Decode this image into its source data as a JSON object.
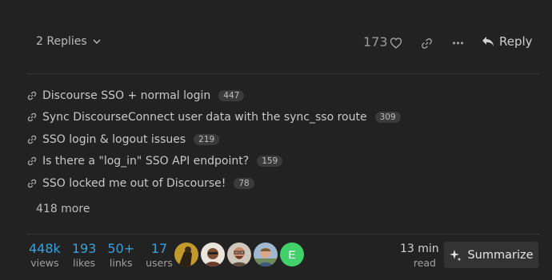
{
  "post_actions": {
    "replies_label": "2 Replies",
    "like_count": "173",
    "reply_label": "Reply"
  },
  "related_links": [
    {
      "title": "Discourse SSO + normal login",
      "count": "447"
    },
    {
      "title": "Sync DiscourseConnect user data with the sync_sso route",
      "count": "309"
    },
    {
      "title": "SSO login & logout issues",
      "count": "219"
    },
    {
      "title": "Is there a \"log_in\" SSO API endpoint?",
      "count": "159"
    },
    {
      "title": "SSO locked me out of Discourse!",
      "count": "78"
    }
  ],
  "more_links_label": "418 more",
  "topic_stats": [
    {
      "value": "448k",
      "label": "views"
    },
    {
      "value": "193",
      "label": "likes"
    },
    {
      "value": "50+",
      "label": "links"
    },
    {
      "value": "17",
      "label": "users"
    }
  ],
  "participants": [
    {
      "icon": "avatar-silhouette",
      "color": "#c29a2b"
    },
    {
      "icon": "avatar-person-beard",
      "color": "#8a5a3c"
    },
    {
      "icon": "avatar-person-glasses",
      "color": "#b77e5c"
    },
    {
      "icon": "avatar-person-outdoor",
      "color": "#7a9cbf"
    },
    {
      "letter": "E",
      "color": "#42d06a"
    }
  ],
  "read_time": {
    "value": "13 min",
    "label": "read"
  },
  "summarize_label": "Summarize",
  "colors": {
    "accent": "#3a9fdb",
    "background": "#222222"
  }
}
